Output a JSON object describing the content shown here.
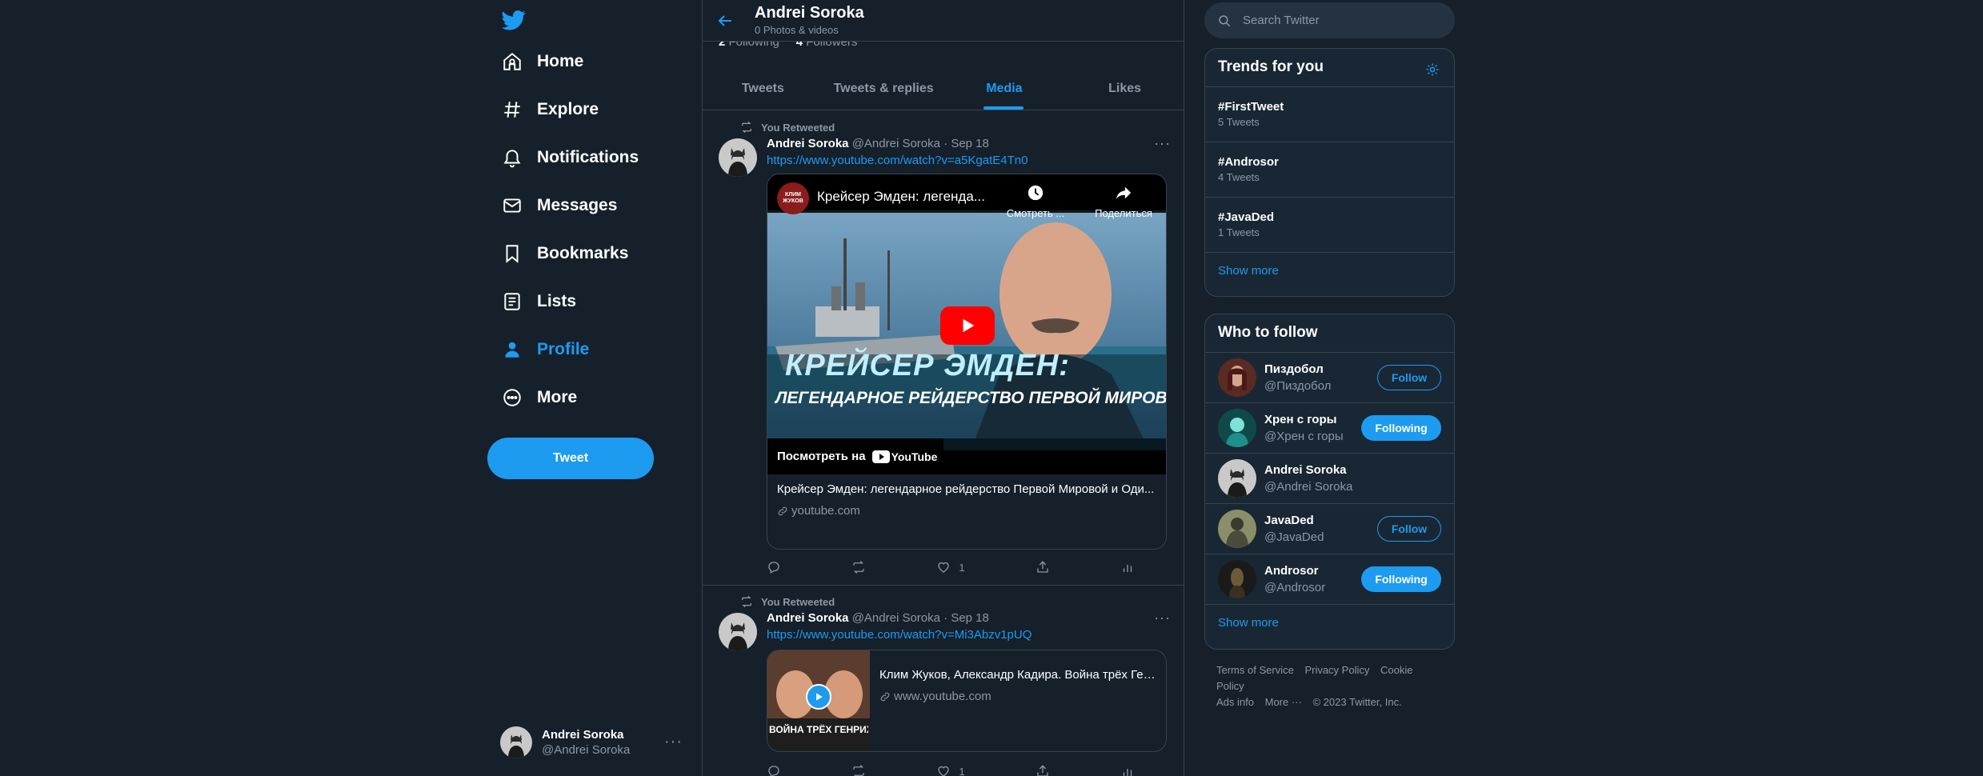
{
  "nav": {
    "items": [
      {
        "label": "Home",
        "icon": "home-icon"
      },
      {
        "label": "Explore",
        "icon": "hashtag-icon"
      },
      {
        "label": "Notifications",
        "icon": "bell-icon"
      },
      {
        "label": "Messages",
        "icon": "envelope-icon"
      },
      {
        "label": "Bookmarks",
        "icon": "bookmark-icon"
      },
      {
        "label": "Lists",
        "icon": "list-icon"
      },
      {
        "label": "Profile",
        "icon": "person-icon"
      },
      {
        "label": "More",
        "icon": "more-circle-icon"
      }
    ],
    "active": "Profile",
    "tweet_button": "Tweet",
    "account": {
      "name": "Andrei Soroka",
      "handle": "@Andrei Soroka"
    }
  },
  "header": {
    "title": "Andrei Soroka",
    "subtitle": "0 Photos & videos"
  },
  "follow_counts": {
    "following_count": "2",
    "following_label": "Following",
    "followers_count": "4",
    "followers_label": "Followers"
  },
  "tabs": [
    "Tweets",
    "Tweets & replies",
    "Media",
    "Likes"
  ],
  "active_tab": "Media",
  "tweets": [
    {
      "retweet_label": "You Retweeted",
      "name": "Andrei Soroka",
      "meta": "@Andrei Soroka · Sep 18",
      "link": "https://www.youtube.com/watch?v=a5KgatE4Tn0",
      "card": {
        "video_title": "Крейсер Эмден: легенда...",
        "watch_later": "Смотреть ...",
        "share": "Поделиться",
        "thumb_line1": "КРЕЙСЕР ЭМДЕН:",
        "thumb_line2": "ЛЕГЕНДАРНОЕ РЕЙДЕРСТВО ПЕРВОЙ МИРОВОЙ",
        "watch_on": "Посмотреть на",
        "youtube": "YouTube",
        "channel_badge": "КЛИМ ЖУКОВ",
        "title": "Крейсер Эмден: легендарное рейдерство Первой Мировой и Оди...",
        "domain": "youtube.com"
      },
      "likes": "1"
    },
    {
      "retweet_label": "You Retweeted",
      "name": "Andrei Soroka",
      "meta": "@Andrei Soroka · Sep 18",
      "link": "https://www.youtube.com/watch?v=Mi3Abzv1pUQ",
      "card": {
        "thumb_text": "ВОЙНА ТРЁХ ГЕНРИХОВ",
        "title": "Клим Жуков, Александр Кадира. Война трёх Ген...",
        "domain": "www.youtube.com"
      },
      "likes": "1"
    }
  ],
  "search": {
    "placeholder": "Search Twitter"
  },
  "trends": {
    "title": "Trends for you",
    "items": [
      {
        "tag": "#FirstTweet",
        "count": "5 Tweets"
      },
      {
        "tag": "#Androsor",
        "count": "4 Tweets"
      },
      {
        "tag": "#JavaDed",
        "count": "1 Tweets"
      }
    ],
    "show_more": "Show more"
  },
  "who_to_follow": {
    "title": "Who to follow",
    "items": [
      {
        "name": "Пиздобол",
        "handle": "@Пиздобол",
        "button": "Follow"
      },
      {
        "name": "Хрен с горы",
        "handle": "@Хрен с горы",
        "button": "Following"
      },
      {
        "name": "Andrei Soroka",
        "handle": "@Andrei Soroka",
        "button": ""
      },
      {
        "name": "JavaDed",
        "handle": "@JavaDed",
        "button": "Follow"
      },
      {
        "name": "Androsor",
        "handle": "@Androsor",
        "button": "Following"
      }
    ],
    "show_more": "Show more"
  },
  "footer": {
    "links": [
      "Terms of Service",
      "Privacy Policy",
      "Cookie Policy",
      "Ads info",
      "More ···"
    ],
    "copyright": "© 2023 Twitter, Inc."
  },
  "colors": {
    "background": "#15202b",
    "panel": "#192734",
    "accent": "#1d9bf0",
    "border": "#38444d",
    "muted": "#8b98a5"
  }
}
